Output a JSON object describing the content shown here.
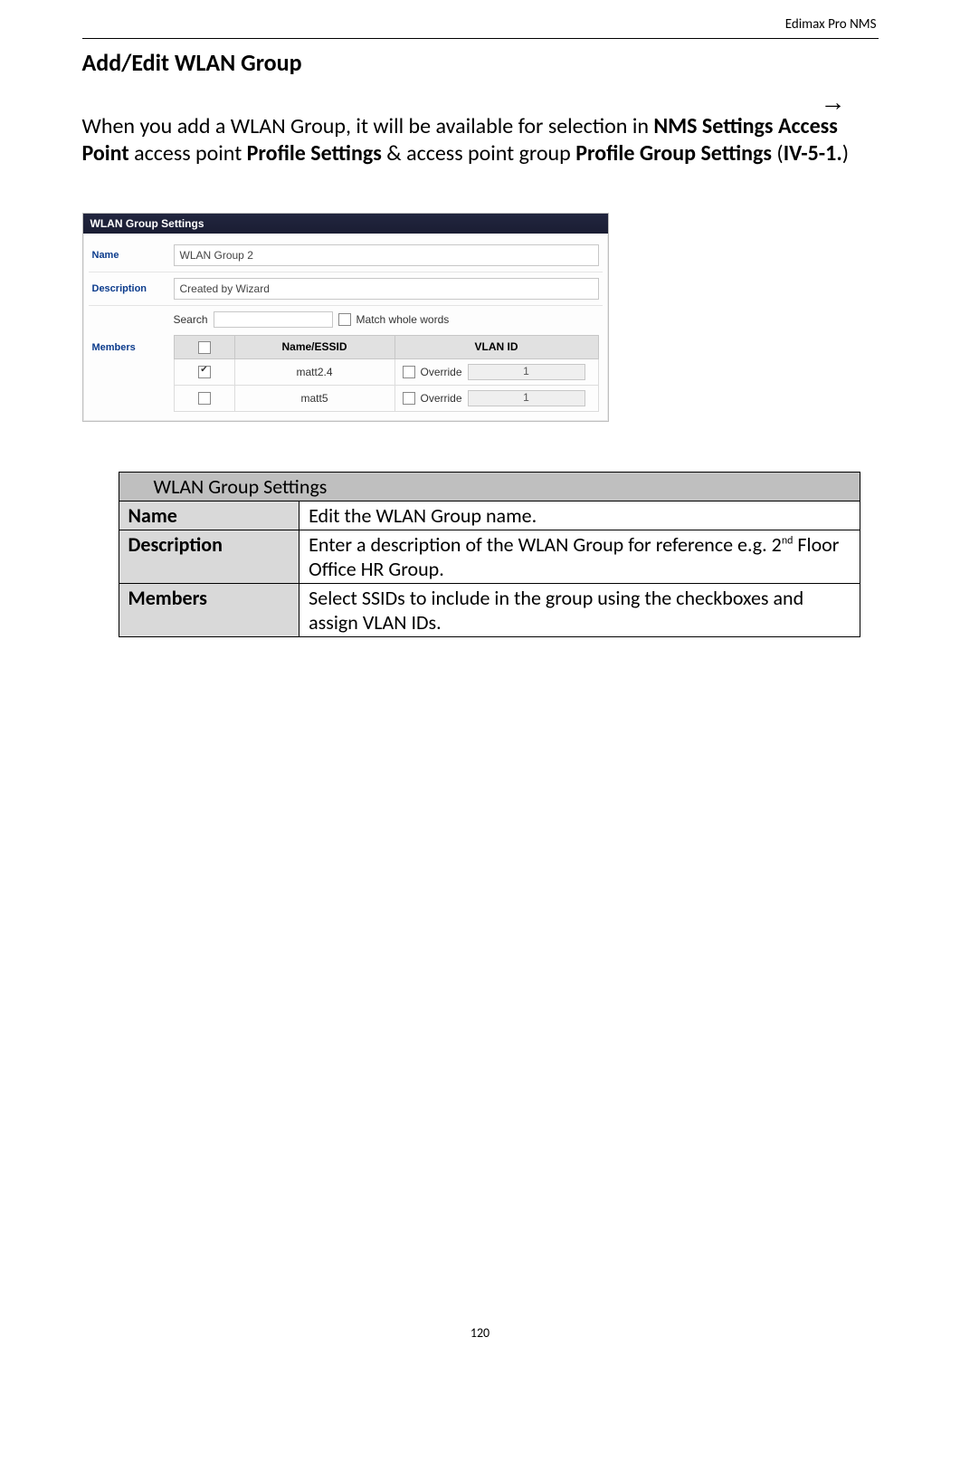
{
  "header": {
    "product": "Edimax Pro NMS"
  },
  "title": "Add/Edit WLAN Group",
  "intro": {
    "pre": "When you add a WLAN Group, it will be available for selection in ",
    "b1": "NMS Settings",
    "arrow": "→",
    "b2": "Access Point",
    "mid1": " access point ",
    "b3": "Profile Settings",
    "mid2": " & access point group ",
    "b4": "Profile Group Settings",
    "mid3": " (",
    "b5": "IV-5-1.",
    "mid4": ")"
  },
  "shot": {
    "titlebar": "WLAN Group Settings",
    "name_label": "Name",
    "name_value": "WLAN Group 2",
    "desc_label": "Description",
    "desc_value": "Created by Wizard",
    "members_label": "Members",
    "search_label": "Search",
    "match_label": "Match whole words",
    "col_check": "",
    "col_name": "Name/ESSID",
    "col_vlan": "VLAN ID",
    "override_label": "Override",
    "rows": [
      {
        "checked": true,
        "name": "matt2.4",
        "override": false,
        "vlan": "1"
      },
      {
        "checked": false,
        "name": "matt5",
        "override": false,
        "vlan": "1"
      }
    ]
  },
  "def": {
    "section_title": "WLAN Group Settings",
    "rows": [
      {
        "key": "Name",
        "val": "Edit the WLAN Group name."
      },
      {
        "key": "Description",
        "val_pre": "Enter a description of the WLAN Group for reference e.g. 2",
        "val_sup": "nd",
        "val_post": " Floor Office HR Group."
      },
      {
        "key": "Members",
        "val": "Select SSIDs to include in the group using the checkboxes and assign VLAN IDs."
      }
    ]
  },
  "page_number": "120"
}
